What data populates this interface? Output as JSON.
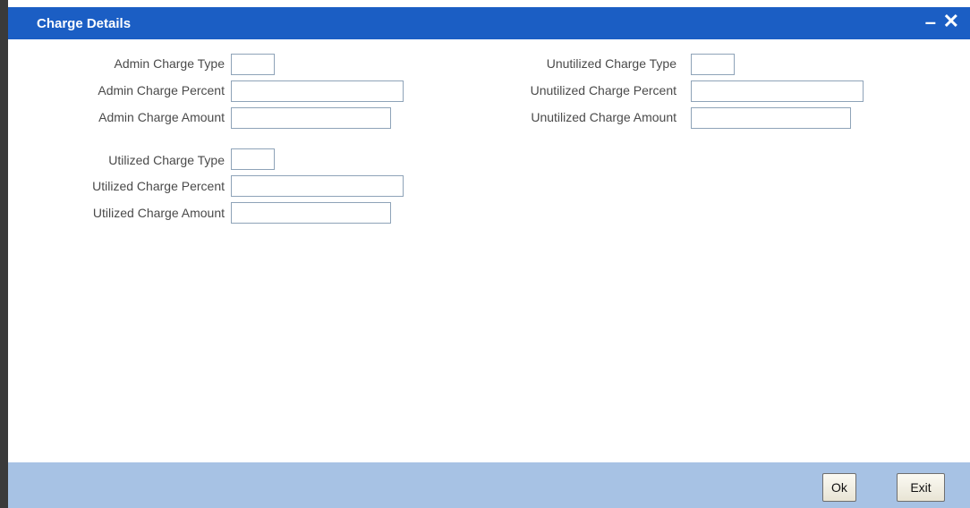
{
  "window": {
    "title": "Charge Details",
    "minimize_glyph": "–",
    "close_glyph": "✕"
  },
  "left_group_1": [
    {
      "label": "Admin Charge Type",
      "value": ""
    },
    {
      "label": "Admin Charge Percent",
      "value": ""
    },
    {
      "label": "Admin Charge Amount",
      "value": ""
    }
  ],
  "left_group_2": [
    {
      "label": "Utilized Charge Type",
      "value": ""
    },
    {
      "label": "Utilized Charge Percent",
      "value": ""
    },
    {
      "label": "Utilized Charge Amount",
      "value": ""
    }
  ],
  "right_group": [
    {
      "label": "Unutilized Charge Type",
      "value": ""
    },
    {
      "label": "Unutilized Charge Percent",
      "value": ""
    },
    {
      "label": "Unutilized Charge Amount",
      "value": ""
    }
  ],
  "footer": {
    "ok_label": "Ok",
    "exit_label": "Exit"
  },
  "colors": {
    "titlebar": "#1b5ec4",
    "footer": "#a7c2e4"
  }
}
